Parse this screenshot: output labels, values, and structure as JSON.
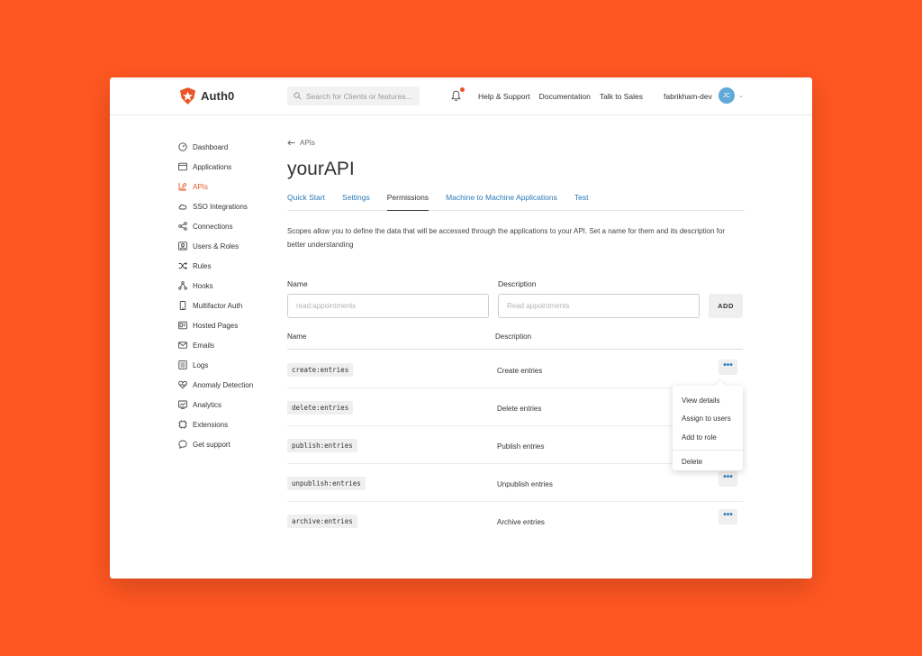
{
  "brand": {
    "name": "Auth0",
    "accent": "#eb5424",
    "link_color": "#2a7ab8",
    "background": "#ff5722"
  },
  "header": {
    "search_placeholder": "Search for Clients or features...",
    "links": [
      "Help & Support",
      "Documentation",
      "Talk to Sales"
    ],
    "tenant": "fabrikham-dev",
    "avatar_initials": "JC"
  },
  "sidebar": {
    "items": [
      {
        "label": "Dashboard",
        "icon": "dashboard-icon"
      },
      {
        "label": "Applications",
        "icon": "applications-icon"
      },
      {
        "label": "APIs",
        "icon": "apis-icon",
        "active": true
      },
      {
        "label": "SSO Integrations",
        "icon": "cloud-icon"
      },
      {
        "label": "Connections",
        "icon": "connections-icon"
      },
      {
        "label": "Users & Roles",
        "icon": "users-icon"
      },
      {
        "label": "Rules",
        "icon": "shuffle-icon"
      },
      {
        "label": "Hooks",
        "icon": "hooks-icon"
      },
      {
        "label": "Multifactor Auth",
        "icon": "phone-icon"
      },
      {
        "label": "Hosted Pages",
        "icon": "hosted-pages-icon"
      },
      {
        "label": "Emails",
        "icon": "mail-icon"
      },
      {
        "label": "Logs",
        "icon": "logs-icon"
      },
      {
        "label": "Anomaly Detection",
        "icon": "heart-icon"
      },
      {
        "label": "Analytics",
        "icon": "analytics-icon"
      },
      {
        "label": "Extensions",
        "icon": "chip-icon"
      },
      {
        "label": "Get support",
        "icon": "chat-icon"
      }
    ]
  },
  "main": {
    "breadcrumb": "APIs",
    "title": "yourAPI",
    "tabs": [
      {
        "label": "Quick Start"
      },
      {
        "label": "Settings"
      },
      {
        "label": "Permissions",
        "active": true
      },
      {
        "label": "Machine to Machine Applications"
      },
      {
        "label": "Test"
      }
    ],
    "description": "Scopes allow you to define the data that will be accessed through the applications to your API. Set a name for them and its description for better understanding",
    "form": {
      "name_label": "Name",
      "description_label": "Description",
      "name_placeholder": "read:appointments",
      "description_placeholder": "Read appointments",
      "add_label": "ADD"
    },
    "table": {
      "headers": [
        "Name",
        "Description"
      ],
      "rows": [
        {
          "name": "create:entries",
          "description": "Create entries"
        },
        {
          "name": "delete:entries",
          "description": "Delete entries"
        },
        {
          "name": "publish:entries",
          "description": "Publish entries"
        },
        {
          "name": "unpublish:entries",
          "description": "Unpublish entries"
        },
        {
          "name": "archive:entries",
          "description": "Archive entries"
        }
      ],
      "more_glyph": "•••"
    },
    "dropdown": [
      "View details",
      "Assign to users",
      "Add to role",
      "Delete"
    ]
  }
}
